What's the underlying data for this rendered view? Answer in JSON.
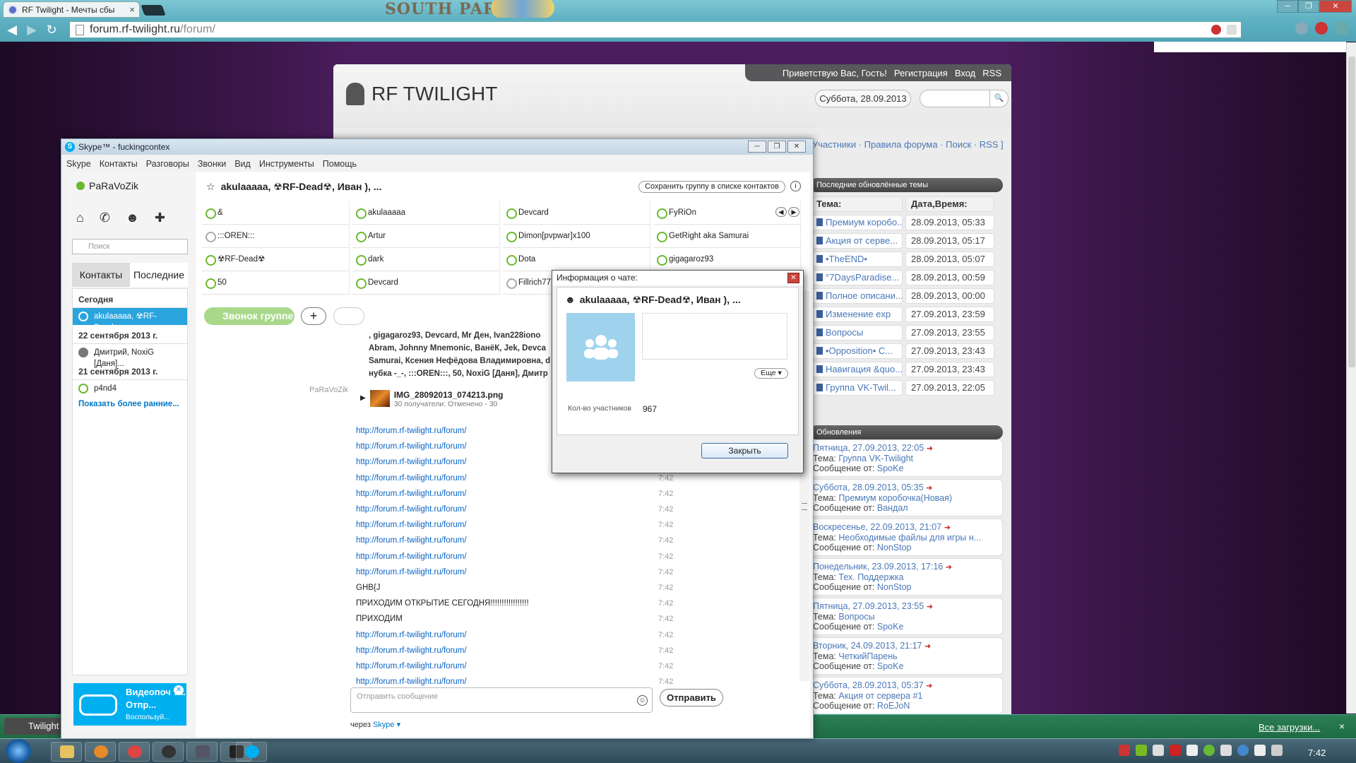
{
  "browser": {
    "tab_title": "RF Twilight - Мечты сбы",
    "tab_close": "×",
    "banner_text": "SOUTH PARK",
    "window_buttons": [
      "─",
      "❐",
      "✕"
    ],
    "url_domain": "forum.rf-twilight.ru",
    "url_path": "/forum/",
    "toolbar_icons": [
      "adblock-icon",
      "translate-icon",
      "refresh-icon",
      "extension-icon",
      "menu-icon"
    ]
  },
  "site": {
    "greeting": "Приветствую Вас, Гость!",
    "register": "Регистрация",
    "login": "Вход",
    "rss": "RSS",
    "logo": "RF TWILIGHT",
    "date": "Суббота, 28.09.2013",
    "search_btn": "🔍",
    "links": "Участники · Правила форума · Поиск · RSS ]",
    "latest_panel": "Последние обновлённые темы",
    "topic_hdr": "Тема:",
    "date_hdr": "Дата,Время:",
    "topics": [
      {
        "t": "Премиум коробо...",
        "d": "28.09.2013, 05:33"
      },
      {
        "t": "Акция от серве...",
        "d": "28.09.2013, 05:17"
      },
      {
        "t": "•TheEND•",
        "d": "28.09.2013, 05:07"
      },
      {
        "t": "°7DaysParadise...",
        "d": "28.09.2013, 00:59"
      },
      {
        "t": "Полное описани...",
        "d": "28.09.2013, 00:00"
      },
      {
        "t": "Изменение exp",
        "d": "27.09.2013, 23:59"
      },
      {
        "t": "Вопросы",
        "d": "27.09.2013, 23:55"
      },
      {
        "t": "•Opposition• C...",
        "d": "27.09.2013, 23:43"
      },
      {
        "t": "Навигация &quo...",
        "d": "27.09.2013, 23:43"
      },
      {
        "t": "Группа VK-Twil...",
        "d": "27.09.2013, 22:05"
      }
    ],
    "updates_panel": "Обновления",
    "updates": [
      {
        "when": "Пятница, 27.09.2013, 22:05",
        "topic": "Группа VK-Twilight",
        "from": "SpoKe"
      },
      {
        "when": "Суббота, 28.09.2013, 05:35",
        "topic": "Премиум коробочка(Новая)",
        "from": "Вандал"
      },
      {
        "when": "Воскресенье, 22.09.2013, 21:07",
        "topic": "Необходимые файлы для игры н...",
        "from": "NonStop"
      },
      {
        "when": "Понедельник, 23.09.2013, 17:16",
        "topic": "Тех. Поддержка",
        "from": "NonStop"
      },
      {
        "when": "Пятница, 27.09.2013, 23:55",
        "topic": "Вопросы",
        "from": "SpoKe"
      },
      {
        "when": "Вторник, 24.09.2013, 21:17",
        "topic": "ЧеткийПарень",
        "from": "SpoKe"
      },
      {
        "when": "Суббота, 28.09.2013, 05:37",
        "topic": "Акция от сервера #1",
        "from": "RoEJoN"
      }
    ],
    "topic_prefix": "Тема:",
    "from_prefix": "Сообщение от:"
  },
  "downloads": {
    "item": "Twilight",
    "all": "Все загрузки...",
    "close": "×"
  },
  "taskbar": {
    "clock": "7:42"
  },
  "skype": {
    "title": "Skype™ - fuckingcontex",
    "menu": [
      "Skype",
      "Контакты",
      "Разговоры",
      "Звонки",
      "Вид",
      "Инструменты",
      "Помощь"
    ],
    "user": "PaRaVoZik",
    "search_placeholder": "Поиск",
    "tab_contacts": "Контакты",
    "tab_recent": "Последние",
    "sections": [
      {
        "label": "Сегодня",
        "items": [
          "akulaaaaa, ☢RF-Dead..."
        ]
      },
      {
        "label": "22 сентября 2013 г.",
        "items": [
          "Дмитрий, NoxiG [Даня]..."
        ]
      },
      {
        "label": "21 сентября 2013 г.",
        "items": [
          "p4nd4"
        ]
      }
    ],
    "show_more": "Показать более ранние...",
    "ad_title": "Видеопоч та. Отпр...",
    "ad_sub": "Воспользуй...",
    "conv_title": "akulaaaaa, ☢RF-Dead☢, Иван ), ...",
    "save_group": "Сохранить группу в списке контактов",
    "participants": [
      "&",
      "akulaaaaa",
      "Devcard",
      "FyRiOn",
      ":::OREN:::",
      "Artur",
      "Dimon[pvpwar]x100",
      "GetRight aka Samurai",
      "☢RF-Dead☢",
      "dark",
      "Dota",
      "gigagaroz93",
      "50",
      "Devcard",
      "Fillrich777",
      ""
    ],
    "call_group": "Звонок группе",
    "old_text": ", gigagaroz93, Devcard, Mr Ден, Ivan228iono Abram, Johnny Mnemonic, ВанёК, Jek, Devca Samurai, Ксения Нефёдова Владимировна, d нубка -_-, :::OREN:::, 50, NoxiG [Даня], Дмитр",
    "sender": "PaRaVoZik",
    "file_name": "IMG_28092013_074213.png",
    "file_status": "30 получатели: Отменено - 30",
    "messages": [
      {
        "text": "http://forum.rf-twilight.ru/forum/",
        "time": "",
        "link": true
      },
      {
        "text": "http://forum.rf-twilight.ru/forum/",
        "time": "",
        "link": true
      },
      {
        "text": "http://forum.rf-twilight.ru/forum/",
        "time": "",
        "link": true
      },
      {
        "text": "http://forum.rf-twilight.ru/forum/",
        "time": "7:42",
        "link": true
      },
      {
        "text": "http://forum.rf-twilight.ru/forum/",
        "time": "7:42",
        "link": true
      },
      {
        "text": "http://forum.rf-twilight.ru/forum/",
        "time": "7:42",
        "link": true
      },
      {
        "text": "http://forum.rf-twilight.ru/forum/",
        "time": "7:42",
        "link": true
      },
      {
        "text": "http://forum.rf-twilight.ru/forum/",
        "time": "7:42",
        "link": true
      },
      {
        "text": "http://forum.rf-twilight.ru/forum/",
        "time": "7:42",
        "link": true
      },
      {
        "text": "http://forum.rf-twilight.ru/forum/",
        "time": "7:42",
        "link": true
      },
      {
        "text": "GHB{J",
        "time": "7:42",
        "link": false
      },
      {
        "text": "ПРИХОДИМ ОТКРЫТИЕ СЕГОДНЯ!!!!!!!!!!!!!!!!!",
        "time": "7:42",
        "link": false
      },
      {
        "text": "ПРИХОДИМ",
        "time": "7:42",
        "link": false
      },
      {
        "text": "http://forum.rf-twilight.ru/forum/",
        "time": "7:42",
        "link": true
      },
      {
        "text": "http://forum.rf-twilight.ru/forum/",
        "time": "7:42",
        "link": true
      },
      {
        "text": "http://forum.rf-twilight.ru/forum/",
        "time": "7:42",
        "link": true
      },
      {
        "text": "http://forum.rf-twilight.ru/forum/",
        "time": "7:42",
        "link": true
      }
    ],
    "compose_placeholder": "Отправить сообщение",
    "send": "Отправить",
    "via": "через",
    "via_link": "Skype ▾"
  },
  "dialog": {
    "title": "Информация о чате:",
    "close_x": "✕",
    "name": "akulaaaaa, ☢RF-Dead☢, Иван ), ...",
    "more": "Еще ▾",
    "count_label": "Кол-во участников",
    "count": "967",
    "close_btn": "Закрыть"
  },
  "colors": {
    "skype_blue": "#00aff0",
    "link": "#0a64c8",
    "call_green": "#a8d88a"
  }
}
